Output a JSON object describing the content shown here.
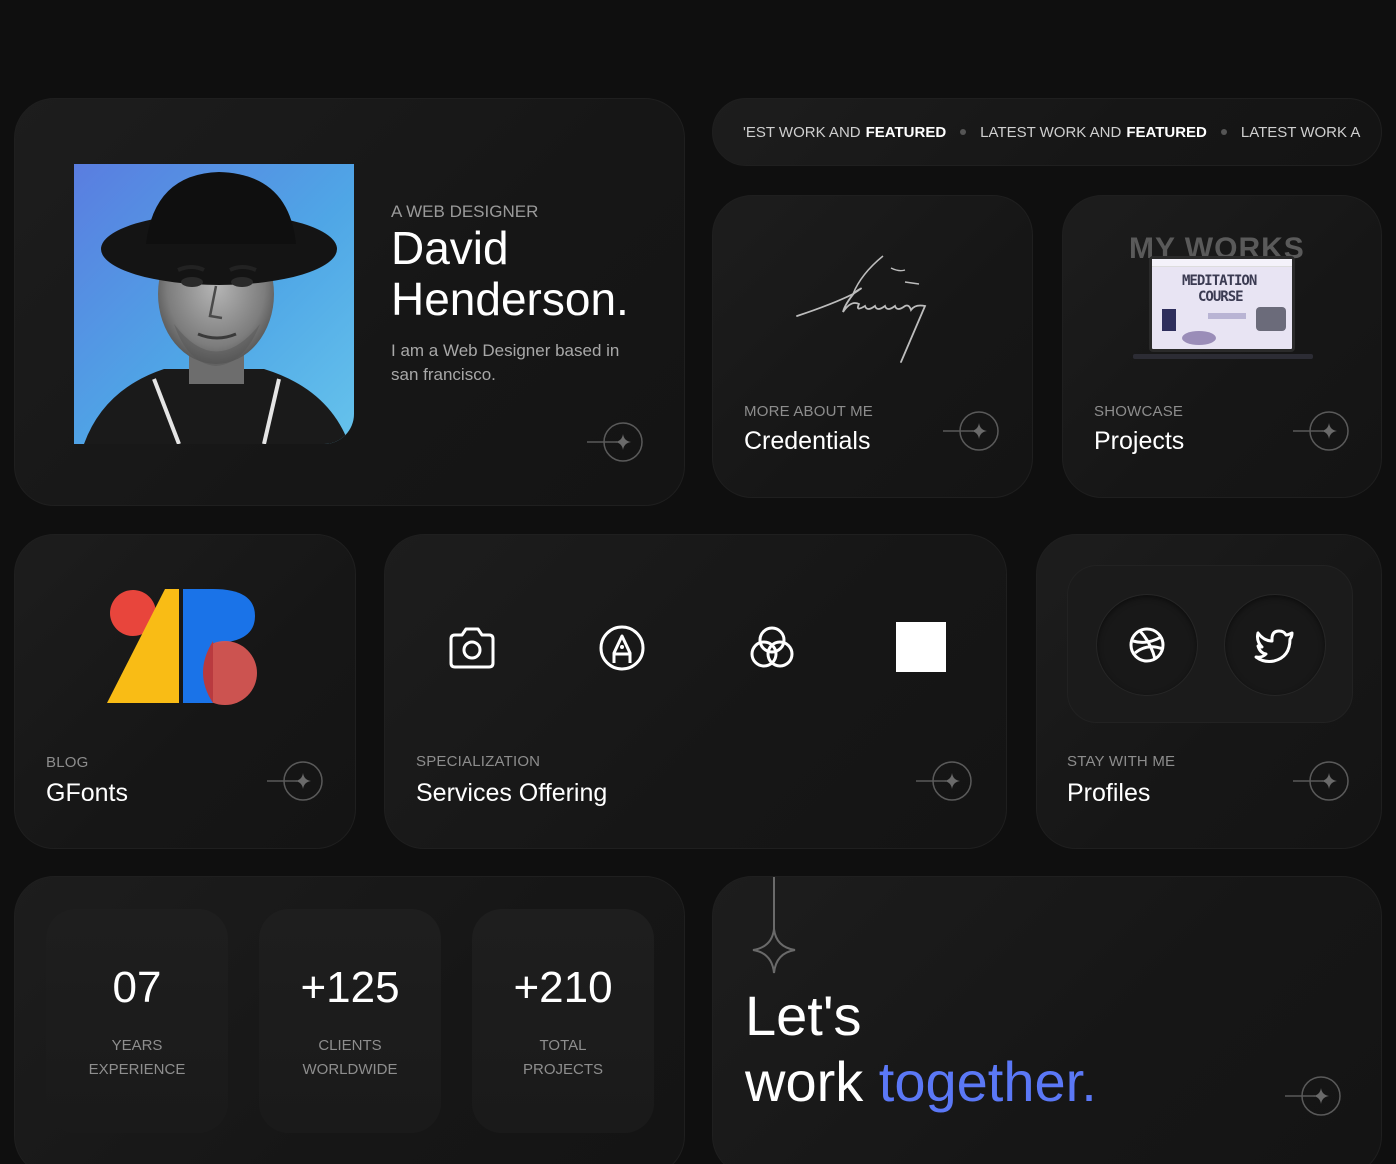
{
  "hero": {
    "role": "A WEB DESIGNER",
    "name": "David Henderson.",
    "bio": "I am a Web Designer based in san francisco."
  },
  "marquee": {
    "items": [
      {
        "regular": "'EST WORK AND",
        "bold": "FEATURED"
      },
      {
        "regular": "LATEST WORK AND",
        "bold": "FEATURED"
      },
      {
        "regular": "LATEST WORK A",
        "bold": ""
      }
    ]
  },
  "credentials": {
    "eyebrow": "MORE ABOUT ME",
    "title": "Credentials"
  },
  "projects": {
    "eyebrow": "SHOWCASE",
    "title": "Projects",
    "thumb_heading": "MY WORKS",
    "thumb_course_line1": "MEDITATION",
    "thumb_course_line2": "COURSE"
  },
  "gfonts": {
    "eyebrow": "BLOG",
    "title": "GFonts"
  },
  "services": {
    "eyebrow": "SPECIALIZATION",
    "title": "Services Offering",
    "icons": [
      "camera-icon",
      "pen-nib-icon",
      "venn-circles-icon",
      "square-icon"
    ]
  },
  "profiles": {
    "eyebrow": "STAY WITH ME",
    "title": "Profiles",
    "icons": [
      "dribbble-icon",
      "twitter-icon"
    ]
  },
  "stats": [
    {
      "value": "07",
      "label_line1": "YEARS",
      "label_line2": "EXPERIENCE"
    },
    {
      "value": "+125",
      "label_line1": "CLIENTS",
      "label_line2": "WORLDWIDE"
    },
    {
      "value": "+210",
      "label_line1": "TOTAL",
      "label_line2": "PROJECTS"
    }
  ],
  "cta": {
    "line1": "Let's",
    "line2_plain": "work",
    "line2_accent": "together.",
    "accent_color": "#5b78f6"
  },
  "colors": {
    "background": "#0f0f0f",
    "card": "#1a1a1a",
    "accent": "#5b78f6",
    "logo_red": "#e8453c",
    "logo_yellow": "#f9bc15",
    "logo_blue": "#1a73e8"
  }
}
